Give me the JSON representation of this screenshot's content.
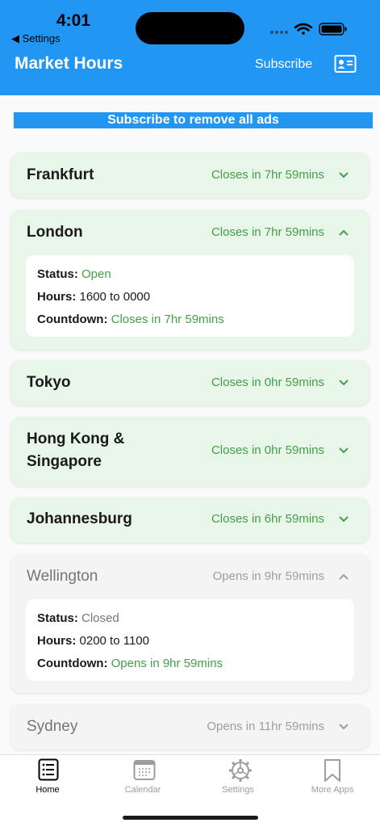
{
  "status_bar": {
    "time": "4:01",
    "back_label": "◀ Settings"
  },
  "header": {
    "title": "Market Hours",
    "subscribe_label": "Subscribe"
  },
  "banner": "Subscribe to remove all ads",
  "labels": {
    "status": "Status:",
    "hours": "Hours:",
    "countdown": "Countdown:"
  },
  "markets": [
    {
      "city": "Frankfurt",
      "countdown": "Closes in 7hr 59mins",
      "state": "open",
      "expanded": false
    },
    {
      "city": "London",
      "countdown": "Closes in 7hr 59mins",
      "state": "open",
      "expanded": true,
      "status": "Open",
      "hours": "1600 to 0000",
      "detail_countdown": "Closes in 7hr 59mins"
    },
    {
      "city": "Tokyo",
      "countdown": "Closes in 0hr 59mins",
      "state": "open",
      "expanded": false
    },
    {
      "city_line1": "Hong Kong &",
      "city_line2": "Singapore",
      "countdown": "Closes in 0hr 59mins",
      "state": "open",
      "expanded": false
    },
    {
      "city": "Johannesburg",
      "countdown": "Closes in 6hr 59mins",
      "state": "open",
      "expanded": false
    },
    {
      "city": "Wellington",
      "countdown": "Opens in 9hr 59mins",
      "state": "closed",
      "expanded": true,
      "status": "Closed",
      "hours": "0200 to 1100",
      "detail_countdown": "Opens in 9hr 59mins"
    },
    {
      "city": "Sydney",
      "countdown": "Opens in 11hr 59mins",
      "state": "closed",
      "expanded": false
    }
  ],
  "tabs": [
    {
      "label": "Home",
      "icon": "list-icon",
      "active": true
    },
    {
      "label": "Calendar",
      "icon": "calendar-icon",
      "active": false
    },
    {
      "label": "Settings",
      "icon": "gear-icon",
      "active": false
    },
    {
      "label": "More Apps",
      "icon": "bookmark-icon",
      "active": false
    }
  ],
  "colors": {
    "brand_blue": "#2196f3",
    "open_card": "#e8f5e9",
    "closed_card": "#f4f4f4",
    "open_text": "#43a047",
    "closed_text": "#9e9e9e"
  }
}
